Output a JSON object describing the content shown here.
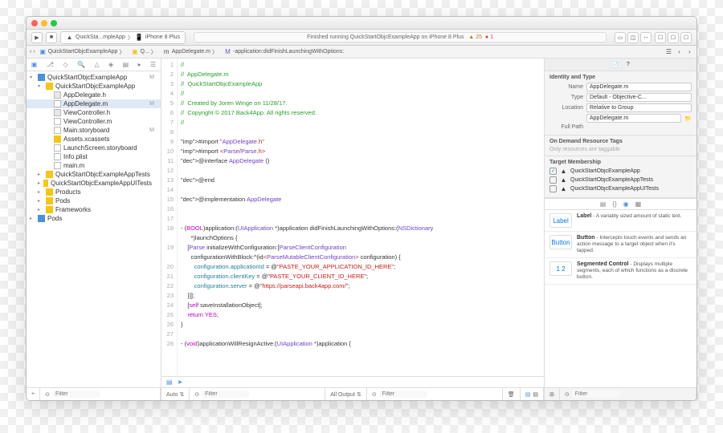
{
  "titlebar": {
    "close": "close",
    "min": "minimize",
    "max": "maximize"
  },
  "toolbar": {
    "run": "▶",
    "stop": "■",
    "scheme_app": "QuickSta...mpleApp",
    "scheme_dev": "iPhone 8 Plus",
    "status": "Finished running QuickStartObjcExampleApp on iPhone 8 Plus",
    "warn_count": "25",
    "err_count": "1"
  },
  "jumpbar": {
    "back": "‹",
    "fwd": "›",
    "p1": "QuickStartObjcExampleApp",
    "p2": "Q...",
    "p3": "AppDelegate.m",
    "p4": "-application:didFinishLaunchingWithOptions:"
  },
  "nav": {
    "items": [
      {
        "ind": 0,
        "disc": "▾",
        "ico": "fblue",
        "label": "QuickStartObjcExampleApp",
        "m": "M"
      },
      {
        "ind": 1,
        "disc": "▾",
        "ico": "fyellow",
        "label": "QuickStartObjcExampleApp",
        "m": ""
      },
      {
        "ind": 2,
        "disc": "",
        "ico": "fh",
        "label": "AppDelegate.h",
        "m": ""
      },
      {
        "ind": 2,
        "disc": "",
        "ico": "fc",
        "label": "AppDelegate.m",
        "m": "M",
        "sel": true
      },
      {
        "ind": 2,
        "disc": "",
        "ico": "fh",
        "label": "ViewController.h",
        "m": ""
      },
      {
        "ind": 2,
        "disc": "",
        "ico": "fc",
        "label": "ViewController.m",
        "m": ""
      },
      {
        "ind": 2,
        "disc": "",
        "ico": "fc",
        "label": "Main.storyboard",
        "m": "M"
      },
      {
        "ind": 2,
        "disc": "",
        "ico": "fyellow",
        "label": "Assets.xcassets",
        "m": ""
      },
      {
        "ind": 2,
        "disc": "",
        "ico": "fc",
        "label": "LaunchScreen.storyboard",
        "m": ""
      },
      {
        "ind": 2,
        "disc": "",
        "ico": "fc",
        "label": "Info.plist",
        "m": ""
      },
      {
        "ind": 2,
        "disc": "",
        "ico": "fc",
        "label": "main.m",
        "m": ""
      },
      {
        "ind": 1,
        "disc": "▸",
        "ico": "fyellow",
        "label": "QuickStartObjcExampleAppTests",
        "m": ""
      },
      {
        "ind": 1,
        "disc": "▸",
        "ico": "fyellow",
        "label": "QuickStartObjcExampleAppUITests",
        "m": ""
      },
      {
        "ind": 1,
        "disc": "▸",
        "ico": "fyellow",
        "label": "Products",
        "m": ""
      },
      {
        "ind": 1,
        "disc": "▸",
        "ico": "fyellow",
        "label": "Pods",
        "m": ""
      },
      {
        "ind": 1,
        "disc": "▸",
        "ico": "fyellow",
        "label": "Frameworks",
        "m": ""
      },
      {
        "ind": 0,
        "disc": "▸",
        "ico": "fblue",
        "label": "Pods",
        "m": ""
      }
    ]
  },
  "code": {
    "lines": [
      {
        "n": 1,
        "t": "//",
        "c": "com"
      },
      {
        "n": 2,
        "t": "//  AppDelegate.m",
        "c": "com"
      },
      {
        "n": 3,
        "t": "//  QuickStartObjcExampleApp",
        "c": "com"
      },
      {
        "n": 4,
        "t": "//",
        "c": "com"
      },
      {
        "n": 5,
        "t": "//  Created by Joren Winge on 11/28/17.",
        "c": "com"
      },
      {
        "n": 6,
        "t": "//  Copyright © 2017 Back4App. All rights reserved.",
        "c": "com"
      },
      {
        "n": 7,
        "t": "//",
        "c": "com"
      },
      {
        "n": 8,
        "t": "",
        "c": ""
      },
      {
        "n": 9,
        "h": "#import \"AppDelegate.h\""
      },
      {
        "n": 10,
        "h": "#import <Parse/Parse.h>"
      },
      {
        "n": 11,
        "h": "@interface AppDelegate ()"
      },
      {
        "n": 12,
        "t": "",
        "c": ""
      },
      {
        "n": 13,
        "h": "@end"
      },
      {
        "n": 14,
        "t": "",
        "c": ""
      },
      {
        "n": 15,
        "h": "@implementation AppDelegate"
      },
      {
        "n": 16,
        "t": "",
        "c": ""
      },
      {
        "n": 17,
        "t": "",
        "c": ""
      },
      {
        "n": 18,
        "h": "- (BOOL)application:(UIApplication *)application didFinishLaunchingWithOptions:(NSDictionary"
      },
      {
        "n": "",
        "h": "      *)launchOptions {"
      },
      {
        "n": 19,
        "h": "    [Parse initializeWithConfiguration:[ParseClientConfiguration"
      },
      {
        "n": "",
        "h": "      configurationWithBlock:^(id<ParseMutableClientConfiguration> configuration) {"
      },
      {
        "n": 20,
        "h": "        configuration.applicationId = @\"PASTE_YOUR_APPLICATION_ID_HERE\";"
      },
      {
        "n": 21,
        "h": "        configuration.clientKey = @\"PASTE_YOUR_CLIENT_ID_HERE\";"
      },
      {
        "n": 22,
        "h": "        configuration.server = @\"https://parseapi.back4app.com/\";"
      },
      {
        "n": 23,
        "t": "    }]];",
        "c": ""
      },
      {
        "n": 24,
        "h": "    [self saveInstallationObject];"
      },
      {
        "n": 25,
        "h": "    return YES;"
      },
      {
        "n": 26,
        "t": "}",
        "c": ""
      },
      {
        "n": 27,
        "t": "",
        "c": ""
      },
      {
        "n": 28,
        "h": "- (void)applicationWillResignActive:(UIApplication *)application {"
      }
    ]
  },
  "bottom": {
    "add": "+",
    "filter_ph": "Filter",
    "auto": "Auto ⇅",
    "all_output": "All Output ⇅"
  },
  "insp": {
    "identity_title": "Identity and Type",
    "name_lbl": "Name",
    "name_val": "AppDelegate.m",
    "type_lbl": "Type",
    "type_val": "Default - Objective-C...",
    "loc_lbl": "Location",
    "loc_val": "Relative to Group",
    "loc_file": "AppDelegate.m",
    "fullpath_lbl": "Full Path",
    "ondemand_title": "On Demand Resource Tags",
    "ondemand_ph": "Only resources are taggable",
    "target_title": "Target Membership",
    "targets": [
      {
        "chk": true,
        "label": "QuickStartObjcExampleApp"
      },
      {
        "chk": false,
        "label": "QuickStartObjcExampleAppTests"
      },
      {
        "chk": false,
        "label": "QuickStartObjcExampleAppUITests"
      }
    ],
    "lib": [
      {
        "ico": "Label",
        "title": "Label",
        "desc": " - A variably sized amount of static text."
      },
      {
        "ico": "Button",
        "title": "Button",
        "desc": " - Intercepts touch events and sends an action message to a target object when it's tapped."
      },
      {
        "ico": "1 2",
        "title": "Segmented Control",
        "desc": " - Displays multiple segments, each of which functions as a discrete button."
      }
    ]
  }
}
